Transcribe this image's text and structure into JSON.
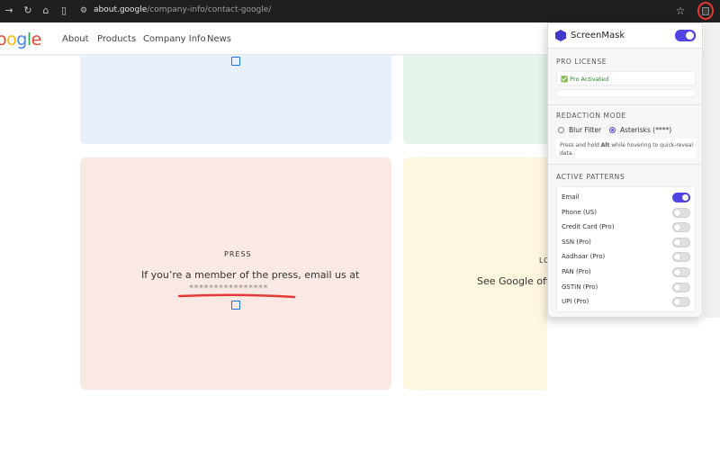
{
  "browser": {
    "url_domain": "about.google",
    "url_path": "/company-info/contact-google/",
    "icons": [
      "forward-icon",
      "reload-icon",
      "home-icon",
      "reader-icon",
      "site-settings-icon",
      "bookmark-star-icon",
      "screenmask-extension-icon"
    ]
  },
  "site": {
    "logo": "oogle",
    "nav": [
      "About",
      "Products",
      "Company Info",
      "News"
    ]
  },
  "cards": {
    "press": {
      "label": "PRESS",
      "text": "If you’re a member of the press, email us at",
      "masked_email": "****************"
    },
    "location": {
      "label_partial": "LO",
      "text_partial": "See Google offi"
    }
  },
  "popup": {
    "brand": "ScreenMask",
    "master_enabled": true,
    "license": {
      "title": "PRO LICENSE",
      "status": "✅ Pro Activated"
    },
    "redaction": {
      "title": "REDACTION MODE",
      "options": [
        "Blur Filter",
        "Asterisks (****)"
      ],
      "selected": "Asterisks (****)",
      "hint_pre": "Press and hold ",
      "hint_key": "Alt",
      "hint_post": " while hovering to quick-reveal data."
    },
    "patterns": {
      "title": "ACTIVE PATTERNS",
      "items": [
        {
          "label": "Email",
          "enabled": true
        },
        {
          "label": "Phone (US)",
          "enabled": false
        },
        {
          "label": "Credit Card (Pro)",
          "enabled": false
        },
        {
          "label": "SSN (Pro)",
          "enabled": false
        },
        {
          "label": "Aadhaar (Pro)",
          "enabled": false
        },
        {
          "label": "PAN (Pro)",
          "enabled": false
        },
        {
          "label": "GSTIN (Pro)",
          "enabled": false
        },
        {
          "label": "UPI (Pro)",
          "enabled": false
        }
      ]
    }
  },
  "colors": {
    "accent": "#4f46e5",
    "annotation_red": "#e53935",
    "card_blue": "#e8f0fe",
    "card_green": "#e6f4ea",
    "card_red": "#fae8e5",
    "card_yellow": "#fef7e0"
  }
}
